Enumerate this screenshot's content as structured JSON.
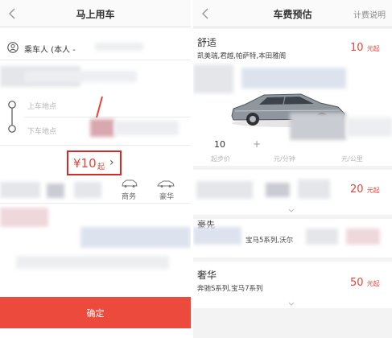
{
  "left": {
    "nav": {
      "title": "马上用车"
    },
    "passenger": {
      "label": "乘车人 (本人 -"
    },
    "pickup": {
      "placeholder": "上车地点"
    },
    "dropoff": {
      "placeholder": "下车地点"
    },
    "price": {
      "amount": "¥10",
      "unit": "起",
      "chevron": "›"
    },
    "car_types": [
      {
        "label": "商务"
      },
      {
        "label": "豪华"
      }
    ],
    "confirm_label": "确定"
  },
  "right": {
    "nav": {
      "title": "车费预估",
      "link": "计费说明"
    },
    "tiers": [
      {
        "name": "舒适",
        "models": "凯美瑞,君越,帕萨特,本田雅阁",
        "price": "10",
        "unit": "元起",
        "start_price": "10",
        "start_label": "起步价",
        "per_min_label": "元/分钟",
        "per_km_label": "元/公里",
        "plus": "+"
      },
      {
        "price": "20",
        "unit": "元起"
      },
      {
        "name_partial": "豪先",
        "models_partial": "宝马5系列,沃尔"
      },
      {
        "name": "奢华",
        "models": "奔驰S系列,宝马7系列",
        "price": "50",
        "unit": "元起"
      }
    ]
  },
  "colors": {
    "accent_red": "#e8443a",
    "button_red": "#eb4a3c",
    "highlight_border": "#d32a2a"
  }
}
